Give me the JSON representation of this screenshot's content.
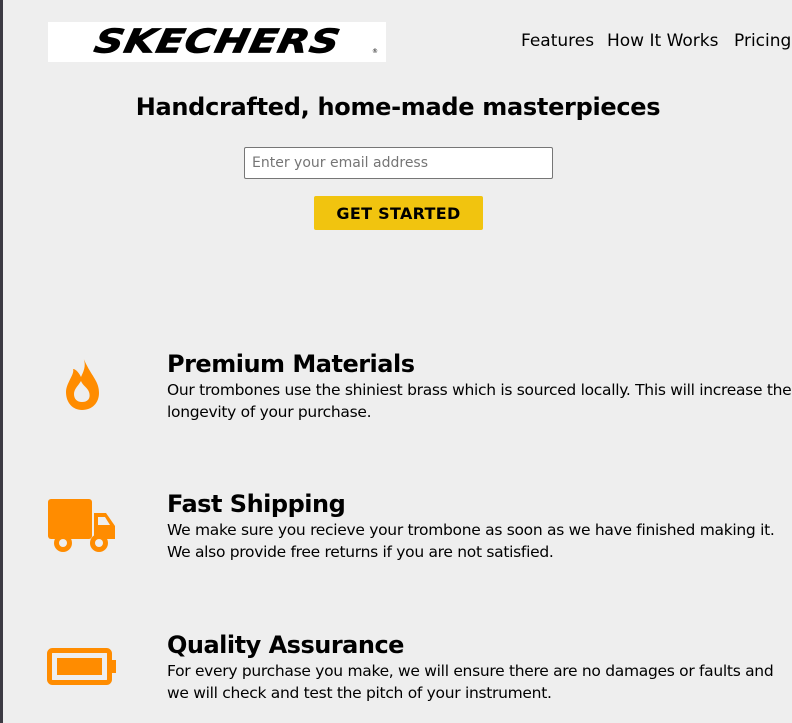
{
  "header": {
    "brand": "SKECHERS",
    "brand_mark": "®",
    "nav": [
      {
        "label": "Features"
      },
      {
        "label": "How It Works"
      },
      {
        "label": "Pricing"
      }
    ]
  },
  "hero": {
    "title": "Handcrafted, home-made masterpieces",
    "email_placeholder": "Enter your email address",
    "email_value": "",
    "cta_label": "GET STARTED"
  },
  "features": [
    {
      "icon": "fire-icon",
      "title": "Premium Materials",
      "description": "Our trombones use the shiniest brass which is sourced locally. This will increase the longevity of your purchase."
    },
    {
      "icon": "truck-icon",
      "title": "Fast Shipping",
      "description": "We make sure you recieve your trombone as soon as we have finished making it. We also provide free returns if you are not satisfied."
    },
    {
      "icon": "battery-icon",
      "title": "Quality Assurance",
      "description": "For every purchase you make, we will ensure there are no damages or faults and we will check and test the pitch of your instrument."
    }
  ],
  "colors": {
    "accent_orange": "#ff8c00",
    "cta_yellow": "#f1c40f",
    "background": "#eeeeee"
  }
}
